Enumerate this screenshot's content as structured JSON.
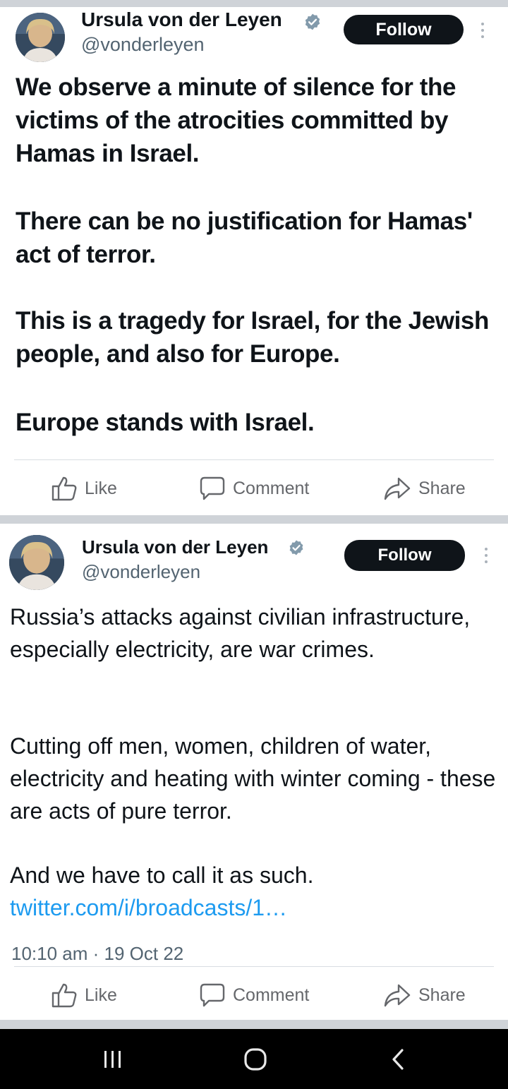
{
  "posts": [
    {
      "author_name": "Ursula von der Leyen",
      "handle": "@vonderleyen",
      "follow_label": "Follow",
      "paragraphs": [
        "We observe a minute of silence for the victims of the atrocities committed by Hamas in Israel.",
        "There can be no justification for Hamas' act of terror.",
        "This is a tragedy for Israel, for the Jewish people, and also for Europe.",
        "Europe stands with Israel."
      ],
      "actions": {
        "like": "Like",
        "comment": "Comment",
        "share": "Share"
      }
    },
    {
      "author_name": "Ursula von der Leyen",
      "handle": "@vonderleyen",
      "follow_label": "Follow",
      "paragraphs": [
        "Russia’s attacks against civilian infrastructure, especially electricity, are war crimes.",
        "Cutting off men, women, children of water, electricity and heating with winter coming - these are acts of pure terror.",
        "And we have to call it as such."
      ],
      "link_text": "twitter.com/i/broadcasts/1…",
      "timestamp": "10:10 am · 19 Oct 22",
      "actions": {
        "like": "Like",
        "comment": "Comment",
        "share": "Share"
      }
    }
  ],
  "colors": {
    "background": "#cfd3d8",
    "card": "#ffffff",
    "text": "#0f1419",
    "secondary_text": "#536471",
    "link": "#1d9bf0",
    "verified": "#829aab",
    "action_text": "#65676b"
  },
  "icons": [
    "verified-badge-icon",
    "more-options-icon",
    "thumbs-up-icon",
    "comment-bubble-icon",
    "share-arrow-icon",
    "recent-apps-icon",
    "home-icon",
    "back-icon"
  ]
}
